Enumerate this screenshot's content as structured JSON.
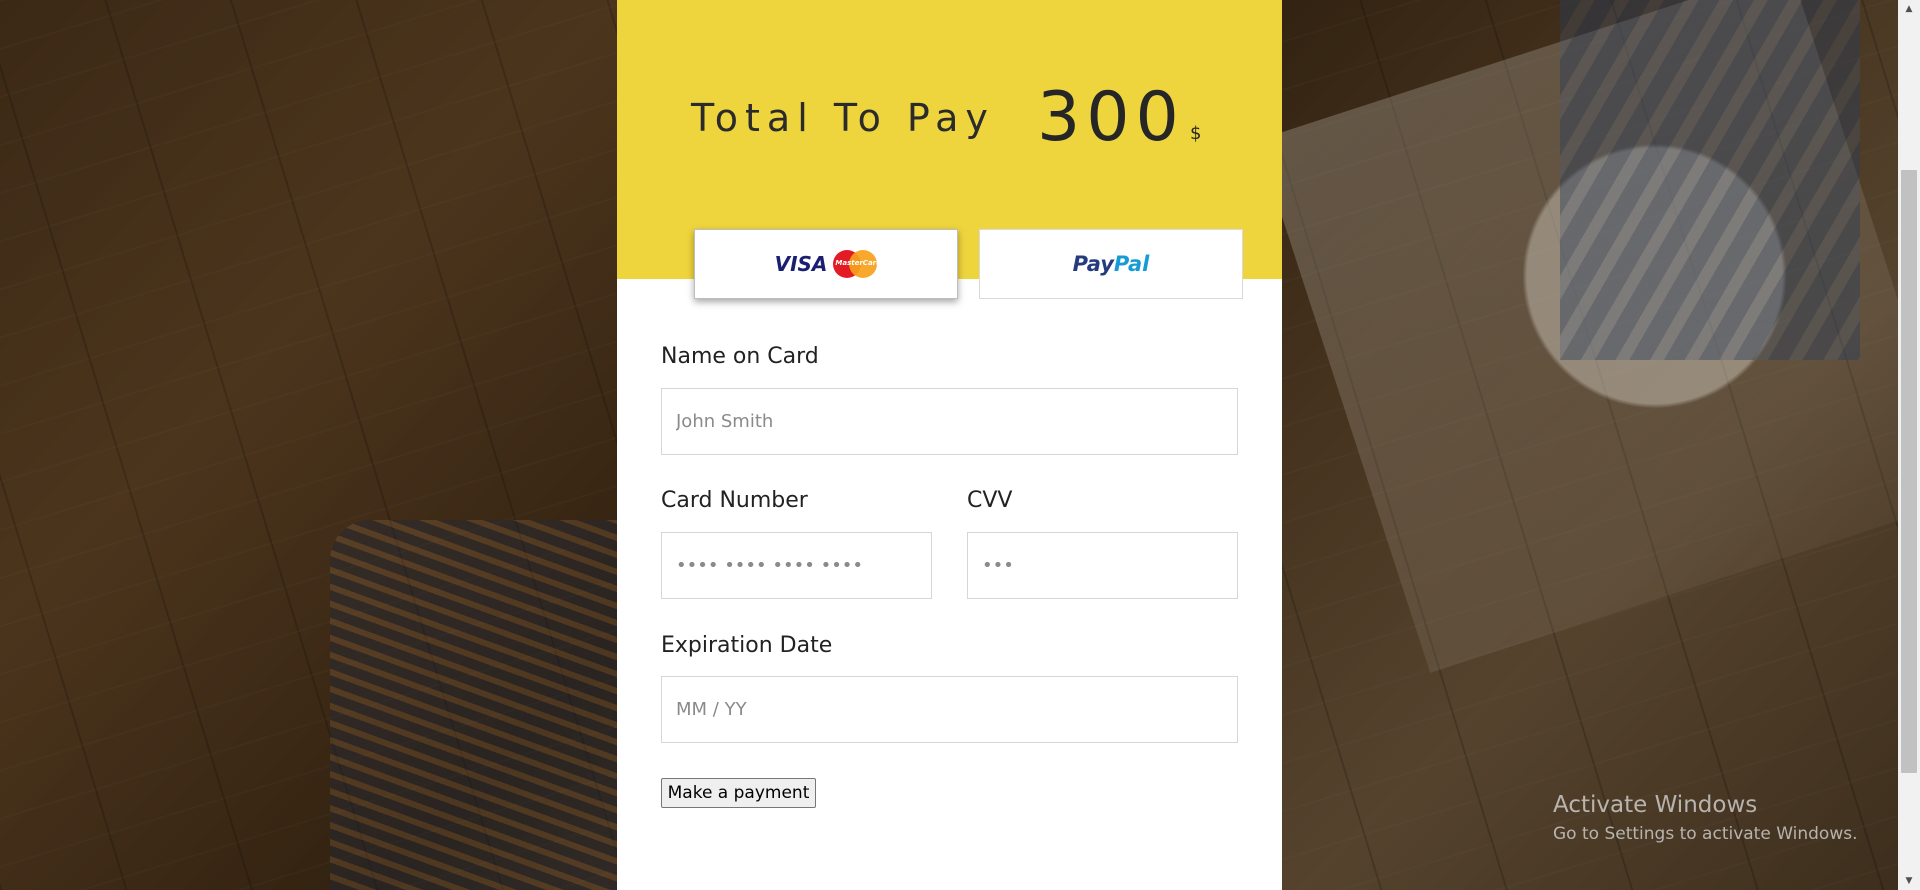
{
  "checkout": {
    "total_label": "Total To Pay",
    "total_amount": "300",
    "currency": "$"
  },
  "payment_methods": {
    "card": {
      "visa_text": "VISA",
      "mastercard_text": "MasterCard",
      "selected": true
    },
    "paypal": {
      "text_part1": "Pay",
      "text_part2": "Pal",
      "selected": false
    }
  },
  "form": {
    "name": {
      "label": "Name on Card",
      "placeholder": "John Smith"
    },
    "card_number": {
      "label": "Card Number",
      "placeholder": "•••• •••• •••• ••••"
    },
    "cvv": {
      "label": "CVV",
      "placeholder": "•••"
    },
    "expiration": {
      "label": "Expiration Date",
      "placeholder": "MM / YY"
    },
    "submit_label": "Make a payment"
  },
  "watermark": {
    "title": "Activate Windows",
    "subtitle": "Go to Settings to activate Windows."
  },
  "colors": {
    "header_yellow": "#efd53d",
    "visa_blue": "#1a1f71",
    "paypal_dark": "#253b80",
    "paypal_light": "#179bd7"
  }
}
